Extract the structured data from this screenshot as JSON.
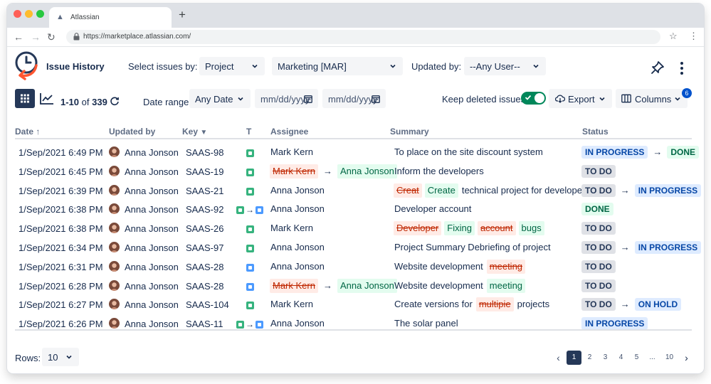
{
  "browser": {
    "tab_title": "Atlassian",
    "new_tab": "+",
    "url": "https://marketplace.atlassian.com/"
  },
  "app": {
    "title": "Issue History",
    "select_by_label": "Select issues by:",
    "select_by_value": "Project",
    "project_value": "Marketing [MAR]",
    "updated_by_label": "Updated by:",
    "updated_by_value": "--Any User--"
  },
  "toolbar": {
    "count_range": "1-10",
    "count_of": "of",
    "count_total": "339",
    "date_range_label": "Date range:",
    "date_range_value": "Any Date",
    "date_from_placeholder": "mm/dd/yyyy",
    "date_to_placeholder": "mm/dd/yyyy",
    "keep_deleted_label": "Keep deleted issues",
    "keep_deleted_on": true,
    "export_label": "Export",
    "columns_label": "Columns",
    "columns_badge": "6"
  },
  "columns": {
    "date": "Date",
    "updated_by": "Updated by",
    "key": "Key",
    "type": "T",
    "assignee": "Assignee",
    "summary": "Summary",
    "status": "Status"
  },
  "rows": [
    {
      "date": "1/Sep/2021 6:49 PM",
      "user": "Anna Jonson",
      "key": "SAAS-98",
      "type": [
        "story"
      ],
      "assignee": [
        {
          "t": "plain",
          "v": "Mark Kern"
        }
      ],
      "summary": [
        {
          "t": "plain",
          "v": "To place on the site discount system"
        }
      ],
      "status": [
        {
          "t": "prog",
          "v": "IN PROGRESS"
        },
        {
          "t": "arrow",
          "v": "→"
        },
        {
          "t": "done",
          "v": "DONE"
        }
      ]
    },
    {
      "date": "1/Sep/2021 6:45 PM",
      "user": "Anna Jonson",
      "key": "SAAS-19",
      "type": [
        "story"
      ],
      "assignee": [
        {
          "t": "del",
          "v": "Mark Kern"
        },
        {
          "t": "arrow",
          "v": "→"
        },
        {
          "t": "add",
          "v": "Anna Jonson"
        }
      ],
      "summary": [
        {
          "t": "plain",
          "v": "Inform the developers"
        }
      ],
      "status": [
        {
          "t": "todo",
          "v": "TO DO"
        }
      ]
    },
    {
      "date": "1/Sep/2021 6:39 PM",
      "user": "Anna Jonson",
      "key": "SAAS-21",
      "type": [
        "story"
      ],
      "assignee": [
        {
          "t": "plain",
          "v": "Anna Jonson"
        }
      ],
      "summary": [
        {
          "t": "del",
          "v": "Creat"
        },
        {
          "t": "add",
          "v": "Create"
        },
        {
          "t": "plain",
          "v": "technical project for developers"
        }
      ],
      "status": [
        {
          "t": "todo",
          "v": "TO DO"
        },
        {
          "t": "arrow",
          "v": "→"
        },
        {
          "t": "prog",
          "v": "IN PROGRESS"
        }
      ]
    },
    {
      "date": "1/Sep/2021 6:38 PM",
      "user": "Anna Jonson",
      "key": "SAAS-92",
      "type": [
        "story",
        "task"
      ],
      "assignee": [
        {
          "t": "plain",
          "v": "Anna Jonson"
        }
      ],
      "summary": [
        {
          "t": "plain",
          "v": "Developer account"
        }
      ],
      "status": [
        {
          "t": "done",
          "v": "DONE"
        }
      ]
    },
    {
      "date": "1/Sep/2021 6:38 PM",
      "user": "Anna Jonson",
      "key": "SAAS-26",
      "type": [
        "story"
      ],
      "assignee": [
        {
          "t": "plain",
          "v": "Mark Kern"
        }
      ],
      "summary": [
        {
          "t": "del",
          "v": "Developer"
        },
        {
          "t": "add",
          "v": "Fixing"
        },
        {
          "t": "del",
          "v": "account"
        },
        {
          "t": "add",
          "v": "bugs"
        }
      ],
      "status": [
        {
          "t": "todo",
          "v": "TO DO"
        }
      ]
    },
    {
      "date": "1/Sep/2021 6:34 PM",
      "user": "Anna Jonson",
      "key": "SAAS-97",
      "type": [
        "story"
      ],
      "assignee": [
        {
          "t": "plain",
          "v": "Anna Jonson"
        }
      ],
      "summary": [
        {
          "t": "plain",
          "v": "Project Summary Debriefing of project"
        }
      ],
      "status": [
        {
          "t": "todo",
          "v": "TO DO"
        },
        {
          "t": "arrow",
          "v": "→"
        },
        {
          "t": "prog",
          "v": "IN PROGRESS"
        }
      ]
    },
    {
      "date": "1/Sep/2021 6:31 PM",
      "user": "Anna Jonson",
      "key": "SAAS-28",
      "type": [
        "task"
      ],
      "assignee": [
        {
          "t": "plain",
          "v": "Anna Jonson"
        }
      ],
      "summary": [
        {
          "t": "plain",
          "v": "Website development"
        },
        {
          "t": "del",
          "v": "meeting"
        }
      ],
      "status": [
        {
          "t": "todo",
          "v": "TO DO"
        }
      ]
    },
    {
      "date": "1/Sep/2021 6:28 PM",
      "user": "Anna Jonson",
      "key": "SAAS-28",
      "type": [
        "task"
      ],
      "assignee": [
        {
          "t": "del",
          "v": "Mark Kern"
        },
        {
          "t": "arrow",
          "v": "→"
        },
        {
          "t": "add",
          "v": "Anna Jonson"
        }
      ],
      "summary": [
        {
          "t": "plain",
          "v": "Website development"
        },
        {
          "t": "add",
          "v": "meeting"
        }
      ],
      "status": [
        {
          "t": "todo",
          "v": "TO DO"
        }
      ]
    },
    {
      "date": "1/Sep/2021 6:27 PM",
      "user": "Anna Jonson",
      "key": "SAAS-104",
      "type": [
        "story"
      ],
      "assignee": [
        {
          "t": "plain",
          "v": "Mark Kern"
        }
      ],
      "summary": [
        {
          "t": "plain",
          "v": "Create versions for"
        },
        {
          "t": "del",
          "v": "multipie"
        },
        {
          "t": "plain",
          "v": "projects"
        }
      ],
      "status": [
        {
          "t": "todo",
          "v": "TO DO"
        },
        {
          "t": "arrow",
          "v": "→"
        },
        {
          "t": "hold",
          "v": "ON HOLD"
        }
      ]
    },
    {
      "date": "1/Sep/2021 6:26 PM",
      "user": "Anna Jonson",
      "key": "SAAS-11",
      "type": [
        "story",
        "task"
      ],
      "assignee": [
        {
          "t": "plain",
          "v": "Anna Jonson"
        }
      ],
      "summary": [
        {
          "t": "plain",
          "v": "The solar panel"
        }
      ],
      "status": [
        {
          "t": "prog",
          "v": "IN PROGRESS"
        }
      ]
    }
  ],
  "footer": {
    "rows_label": "Rows:",
    "rows_value": "10",
    "pages": [
      "1",
      "2",
      "3",
      "4",
      "5",
      "...",
      "10"
    ],
    "current_page": "1"
  },
  "icons": {
    "type_story": "story-icon",
    "type_task": "task-icon"
  },
  "colors": {
    "accent": "#253858",
    "toggle_on": "#00875a",
    "logo_orange": "#ff5630",
    "logo_navy": "#253858"
  }
}
